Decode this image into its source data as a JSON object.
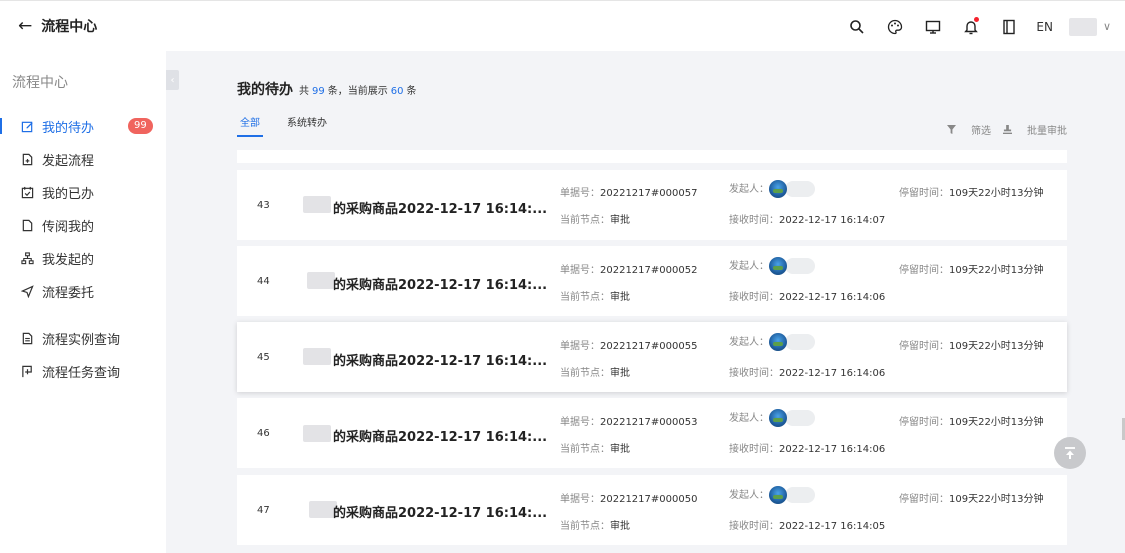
{
  "header": {
    "title": "流程中心",
    "lang": "EN",
    "icons": [
      "search-icon",
      "palette-icon",
      "monitor-icon",
      "bell-icon",
      "book-icon"
    ]
  },
  "sidebar": {
    "title": "流程中心",
    "items": [
      {
        "label": "我的待办",
        "icon": "edit-icon",
        "badge": "99",
        "active": true
      },
      {
        "label": "发起流程",
        "icon": "file-add-icon"
      },
      {
        "label": "我的已办",
        "icon": "calendar-check-icon"
      },
      {
        "label": "传阅我的",
        "icon": "file-icon"
      },
      {
        "label": "我发起的",
        "icon": "org-icon"
      },
      {
        "label": "流程委托",
        "icon": "send-icon"
      },
      {
        "label": "流程实例查询",
        "icon": "doc-search-icon"
      },
      {
        "label": "流程任务查询",
        "icon": "flag-icon"
      }
    ]
  },
  "main": {
    "title": "我的待办",
    "count_prefix": "共",
    "total": "99",
    "count_mid": "条，当前展示",
    "shown": "60",
    "count_suffix": "条",
    "tabs": [
      {
        "label": "全部",
        "active": true
      },
      {
        "label": "系统转办"
      }
    ],
    "filter_label": "筛选",
    "batch_label": "批量审批",
    "labels": {
      "doc_no": "单据号：",
      "initiator": "发起人：",
      "stay": "停留时间：",
      "node": "当前节点：",
      "received": "接收时间："
    },
    "rows": [
      {
        "index": "43",
        "name": "的采购商品2022-12-17 16:14:...",
        "doc_no": "20221217#000057",
        "stay": "109天22小时13分钟",
        "node": "审批",
        "received": "2022-12-17 16:14:07"
      },
      {
        "index": "44",
        "name": "的采购商品2022-12-17 16:14:...",
        "doc_no": "20221217#000052",
        "stay": "109天22小时13分钟",
        "node": "审批",
        "received": "2022-12-17 16:14:06"
      },
      {
        "index": "45",
        "name": "的采购商品2022-12-17 16:14:...",
        "doc_no": "20221217#000055",
        "stay": "109天22小时13分钟",
        "node": "审批",
        "received": "2022-12-17 16:14:06"
      },
      {
        "index": "46",
        "name": "的采购商品2022-12-17 16:14:...",
        "doc_no": "20221217#000053",
        "stay": "109天22小时13分钟",
        "node": "审批",
        "received": "2022-12-17 16:14:06"
      },
      {
        "index": "47",
        "name": "的采购商品2022-12-17 16:14:...",
        "doc_no": "20221217#000050",
        "stay": "109天22小时13分钟",
        "node": "审批",
        "received": "2022-12-17 16:14:05"
      }
    ]
  }
}
